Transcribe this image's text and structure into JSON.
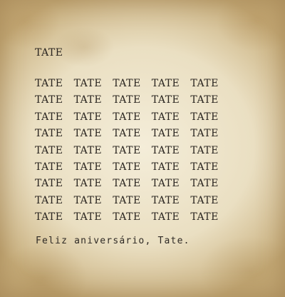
{
  "header": "TATE",
  "grid_word": "TATE",
  "grid_columns": 5,
  "grid_rows": 9,
  "footer": "Feliz aniversário, Tate."
}
